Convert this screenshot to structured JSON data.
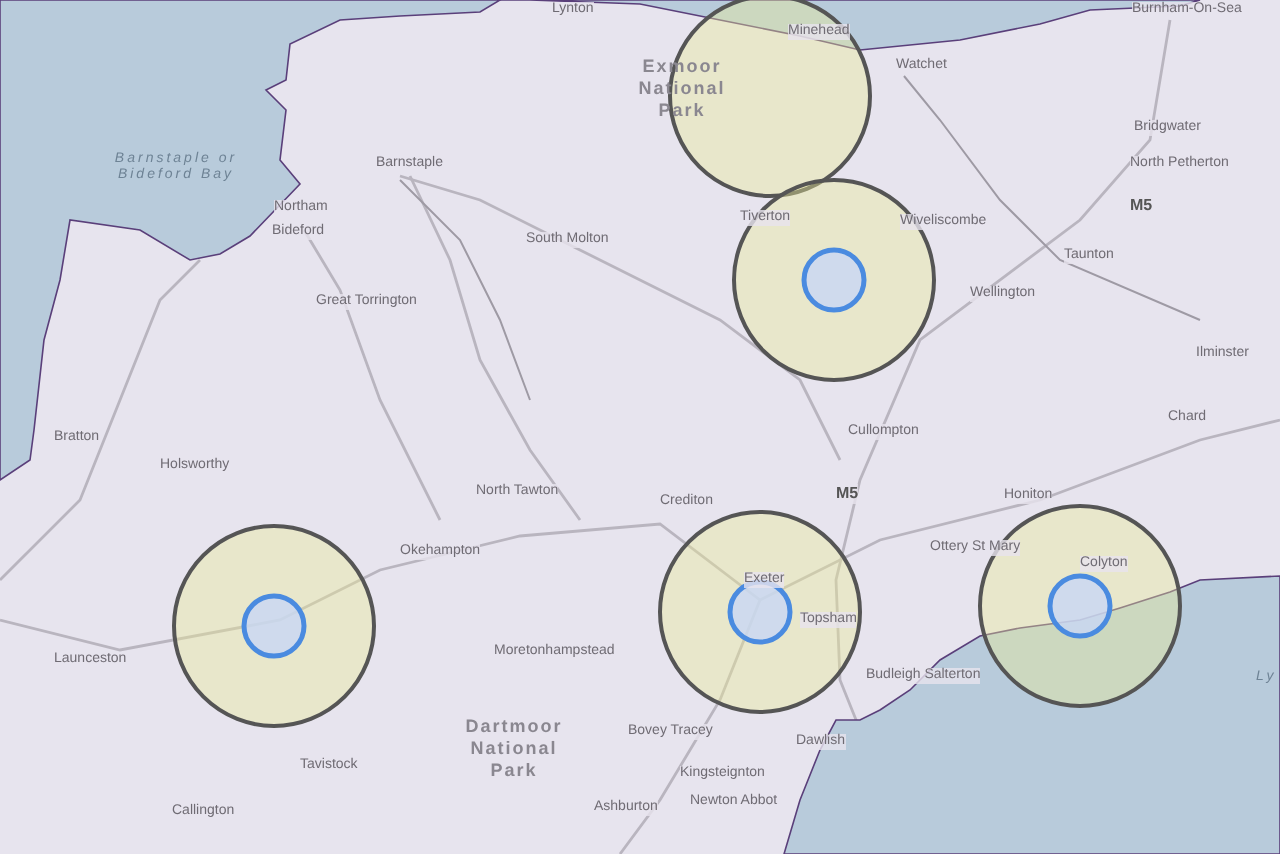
{
  "map": {
    "labels": [
      {
        "text": "Lynton",
        "kind": "town"
      },
      {
        "text": "Minehead",
        "kind": "town"
      },
      {
        "text": "Watchet",
        "kind": "town"
      },
      {
        "text": "Burnham-On-Sea",
        "kind": "town"
      },
      {
        "text": "Exmoor National Park",
        "kind": "park"
      },
      {
        "text": "Barnstaple or Bideford Bay",
        "kind": "sea"
      },
      {
        "text": "Barnstaple",
        "kind": "town"
      },
      {
        "text": "Northam",
        "kind": "town"
      },
      {
        "text": "Bideford",
        "kind": "town"
      },
      {
        "text": "South Molton",
        "kind": "town"
      },
      {
        "text": "Great Torrington",
        "kind": "town"
      },
      {
        "text": "Tiverton",
        "kind": "town"
      },
      {
        "text": "Wiveliscombe",
        "kind": "town"
      },
      {
        "text": "Bridgwater",
        "kind": "town"
      },
      {
        "text": "North Petherton",
        "kind": "town"
      },
      {
        "text": "M5",
        "kind": "road"
      },
      {
        "text": "Taunton",
        "kind": "town"
      },
      {
        "text": "Wellington",
        "kind": "town"
      },
      {
        "text": "Ilminster",
        "kind": "town"
      },
      {
        "text": "Chard",
        "kind": "town"
      },
      {
        "text": "Cullompton",
        "kind": "town"
      },
      {
        "text": "Bratton",
        "kind": "town"
      },
      {
        "text": "Holsworthy",
        "kind": "town"
      },
      {
        "text": "North Tawton",
        "kind": "town"
      },
      {
        "text": "Crediton",
        "kind": "town"
      },
      {
        "text": "M5",
        "kind": "road"
      },
      {
        "text": "Honiton",
        "kind": "town"
      },
      {
        "text": "Okehampton",
        "kind": "town"
      },
      {
        "text": "Ottery St Mary",
        "kind": "town"
      },
      {
        "text": "Colyton",
        "kind": "town"
      },
      {
        "text": "Launceston",
        "kind": "town"
      },
      {
        "text": "Exeter",
        "kind": "town"
      },
      {
        "text": "Topsham",
        "kind": "town"
      },
      {
        "text": "Moretonhampstead",
        "kind": "town"
      },
      {
        "text": "Dartmoor National Park",
        "kind": "park"
      },
      {
        "text": "Budleigh Salterton",
        "kind": "town"
      },
      {
        "text": "Bovey Tracey",
        "kind": "town"
      },
      {
        "text": "Dawlish",
        "kind": "town"
      },
      {
        "text": "Kingsteignton",
        "kind": "town"
      },
      {
        "text": "Newton Abbot",
        "kind": "town"
      },
      {
        "text": "Ashburton",
        "kind": "town"
      },
      {
        "text": "Tavistock",
        "kind": "town"
      },
      {
        "text": "Callington",
        "kind": "town"
      },
      {
        "text": "Ly",
        "kind": "sea"
      }
    ],
    "circles": [
      {
        "marked": false
      },
      {
        "marked": true
      },
      {
        "marked": true
      },
      {
        "marked": true
      },
      {
        "marked": true
      }
    ]
  }
}
